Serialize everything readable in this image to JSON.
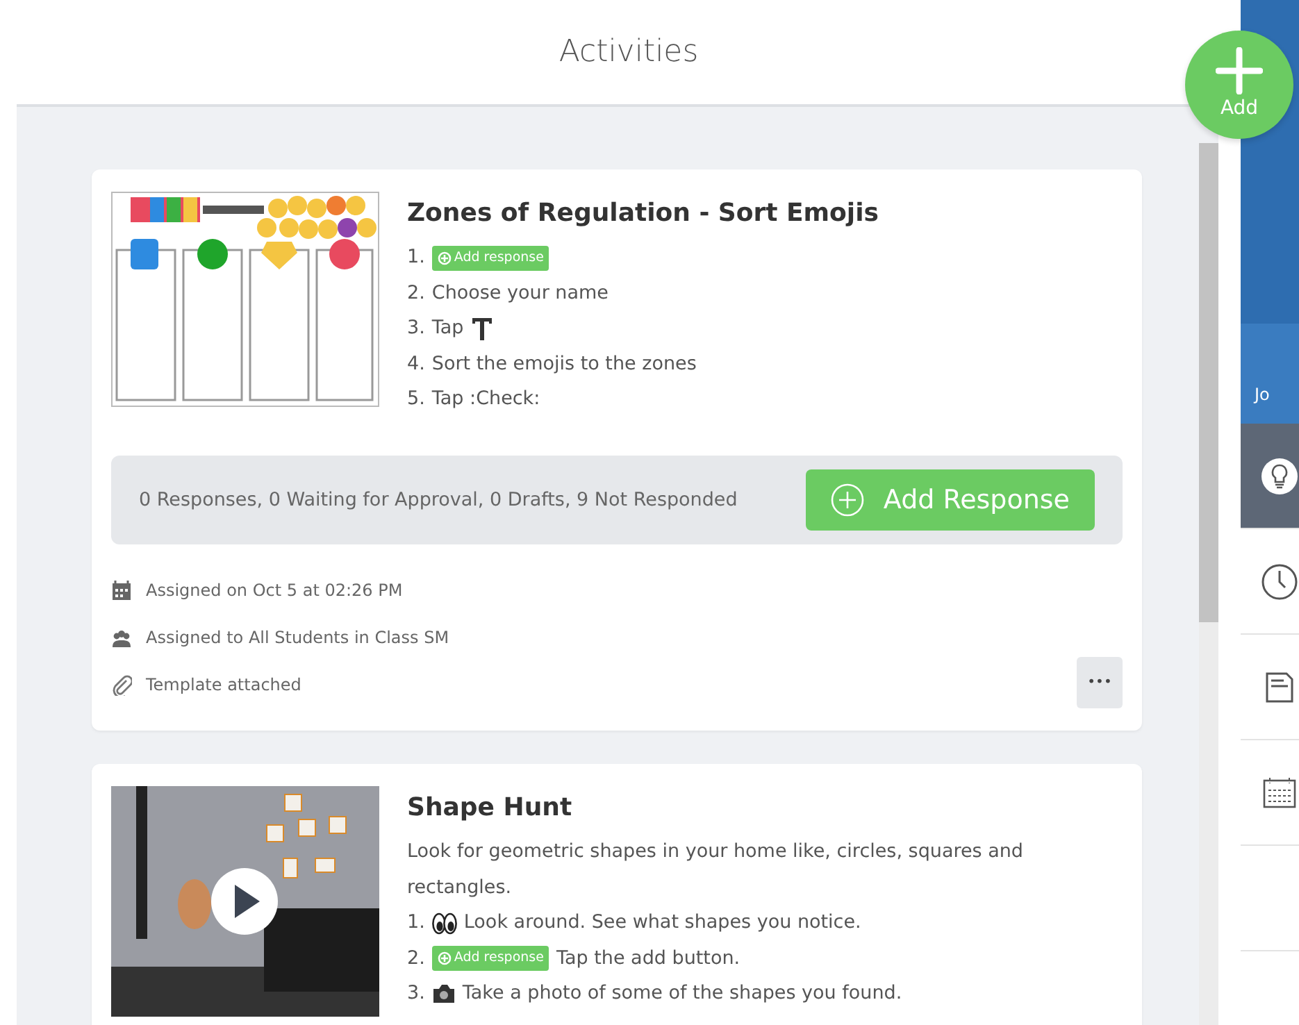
{
  "header": {
    "title": "Activities"
  },
  "add_button": {
    "label": "Add"
  },
  "activities": [
    {
      "title": "Zones of Regulation - Sort Emojis",
      "thumbnail": {
        "kind": "worksheet"
      },
      "steps": [
        {
          "number": "1.",
          "parts": [
            {
              "kind": "badge",
              "text": "Add response"
            }
          ]
        },
        {
          "number": "2.",
          "parts": [
            {
              "kind": "text",
              "text": "Choose your name"
            }
          ]
        },
        {
          "number": "3.",
          "parts": [
            {
              "kind": "text",
              "text": "Tap"
            },
            {
              "kind": "text-tool"
            }
          ]
        },
        {
          "number": "4.",
          "parts": [
            {
              "kind": "text",
              "text": "Sort the emojis to the zones"
            }
          ]
        },
        {
          "number": "5.",
          "parts": [
            {
              "kind": "text",
              "text": "Tap :Check:"
            }
          ]
        }
      ],
      "summary": "0 Responses, 0 Waiting for Approval, 0 Drafts, 9 Not Responded",
      "action": "Add Response",
      "meta": [
        {
          "kind": "calendar",
          "text": "Assigned on Oct 5 at 02:26 PM"
        },
        {
          "kind": "group",
          "text": "Assigned to All Students in Class SM"
        },
        {
          "kind": "paperclip",
          "text": "Template attached"
        }
      ],
      "more": "•••"
    },
    {
      "title": "Shape Hunt",
      "thumbnail": {
        "kind": "video"
      },
      "description": "Look for geometric shapes in your home like, circles, squares and rectangles.",
      "steps": [
        {
          "number": "1.",
          "parts": [
            {
              "kind": "eyes"
            },
            {
              "kind": "text",
              "text": "Look around. See what shapes you notice."
            }
          ]
        },
        {
          "number": "2.",
          "parts": [
            {
              "kind": "badge",
              "text": "Add response"
            },
            {
              "kind": "text",
              "text": "Tap the add button."
            }
          ]
        },
        {
          "number": "3.",
          "parts": [
            {
              "kind": "camera"
            },
            {
              "kind": "text",
              "text": "Take a photo of some of the shapes you found."
            }
          ]
        }
      ]
    }
  ],
  "sidebar": {
    "profile_text": "Jo",
    "items": [
      {
        "selected": true
      },
      {
        "selected": false
      },
      {
        "selected": false
      },
      {
        "selected": false
      },
      {
        "selected": false
      }
    ]
  }
}
